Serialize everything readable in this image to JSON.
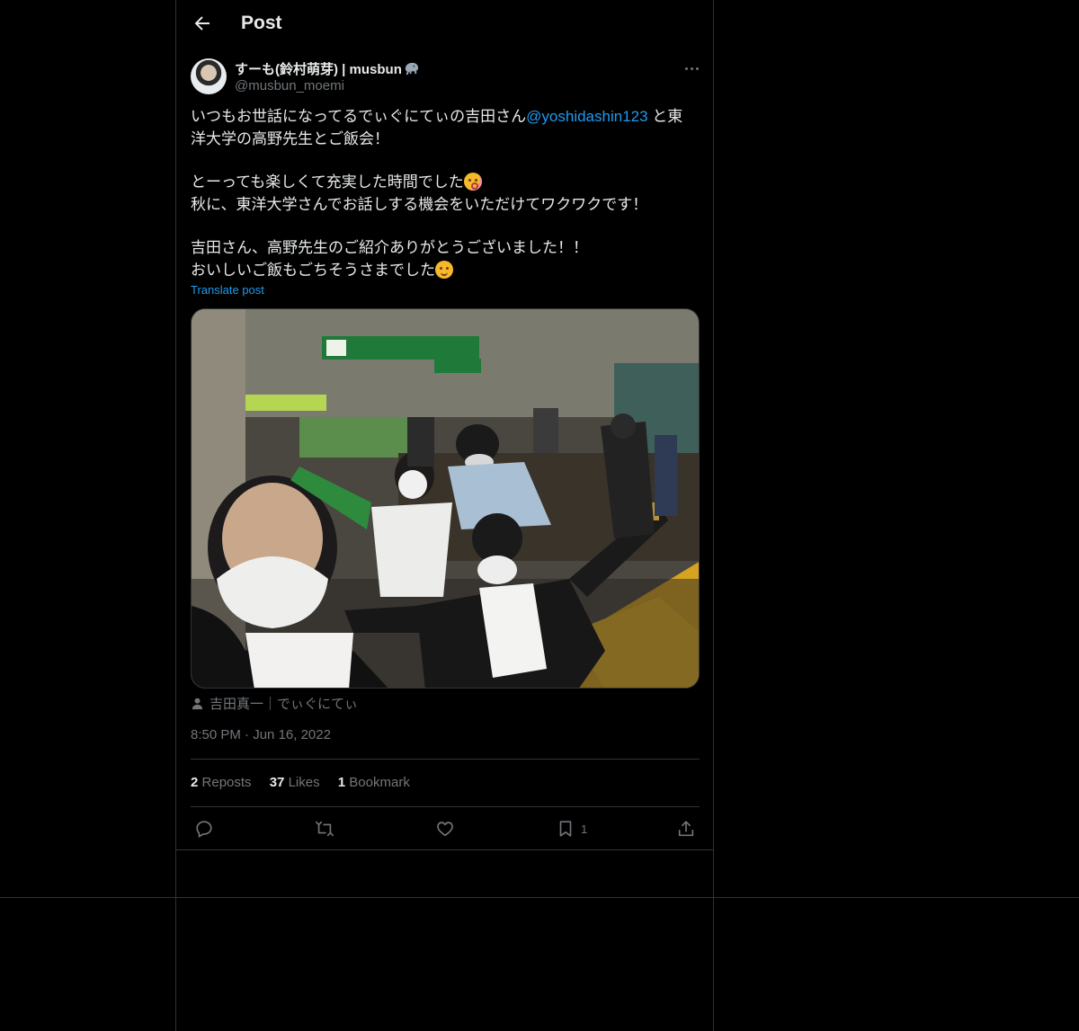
{
  "header": {
    "title": "Post"
  },
  "author": {
    "name": "すーも(鈴村萌芽) | musbun",
    "name_emoji": "elephant-emoji",
    "handle": "@musbun_moemi"
  },
  "post": {
    "line1_prefix": "いつもお世話になってるでぃぐにてぃの吉田さん",
    "mention": "@yoshidashin123",
    "line1_suffix": " と東",
    "line2": "洋大学の高野先生とご飯会！",
    "line3": "とーっても楽しくて充実した時間でした",
    "line4": "秋に、東洋大学さんでお話しする機会をいただけてワクワクです！",
    "line5": "吉田さん、高野先生のご紹介ありがとうございました！！",
    "line6": "おいしいご飯もごちそうさまでした",
    "translate": "Translate post"
  },
  "photo": {
    "alt_semantic": "group-selfie-at-station"
  },
  "tagged": "吉田真一｜でぃぐにてぃ",
  "timestamp": {
    "time": "8:50 PM",
    "sep": "·",
    "date": "Jun 16, 2022"
  },
  "stats": {
    "reposts_count": "2",
    "reposts_label": "Reposts",
    "likes_count": "37",
    "likes_label": "Likes",
    "bookmarks_count": "1",
    "bookmarks_label": "Bookmark"
  },
  "actions": {
    "bookmark_count": "1"
  },
  "colors": {
    "background": "#000000",
    "text": "#e7e9ea",
    "muted": "#71767b",
    "accent": "#1d9bf0",
    "border": "#2f3336"
  }
}
